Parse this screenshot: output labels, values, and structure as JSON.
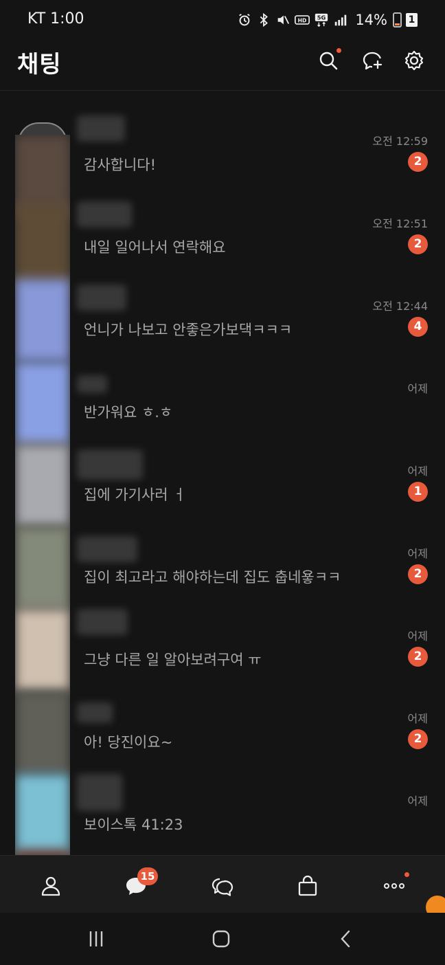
{
  "status_bar": {
    "carrier_time": "KT 1:00",
    "battery": "14%",
    "box_badge": "1"
  },
  "header": {
    "title": "채팅",
    "icons": [
      "search-icon",
      "new-chat-icon",
      "settings-icon"
    ]
  },
  "chats": [
    {
      "name": "",
      "preview": "감사합니다!",
      "time": "오전 12:59",
      "unread": "2"
    },
    {
      "name": "",
      "preview": "내일 일어나서 연락해요",
      "time": "오전 12:51",
      "unread": "2"
    },
    {
      "name": "",
      "preview": "언니가 나보고 안좋은가보댁ㅋㅋㅋ",
      "time": "오전 12:44",
      "unread": "4"
    },
    {
      "name": "",
      "preview": "반가워요 ㅎ.ㅎ",
      "time": "어제",
      "unread": ""
    },
    {
      "name": "",
      "preview": "집에 가기사러 ㅓ",
      "time": "어제",
      "unread": "1"
    },
    {
      "name": "",
      "preview": "집이 최고라고 해야하는데 집도 춥네욯ㅋㅋ",
      "time": "어제",
      "unread": "2"
    },
    {
      "name": "",
      "preview": "그냥 다른 일 알아보려구여 ㅠ",
      "time": "어제",
      "unread": "2"
    },
    {
      "name": "",
      "preview": "아! 당진이요~",
      "time": "어제",
      "unread": "2"
    },
    {
      "name": "",
      "preview": "보이스톡 41:23",
      "time": "어제",
      "unread": ""
    }
  ],
  "bottom_nav": {
    "items": [
      "friends-icon",
      "chats-icon",
      "openchat-icon",
      "shopping-icon",
      "more-icon"
    ],
    "chats_badge": "15"
  },
  "colors": {
    "background": "#141414",
    "badge": "#e85a3c",
    "accent_dot": "#f05a3a"
  }
}
